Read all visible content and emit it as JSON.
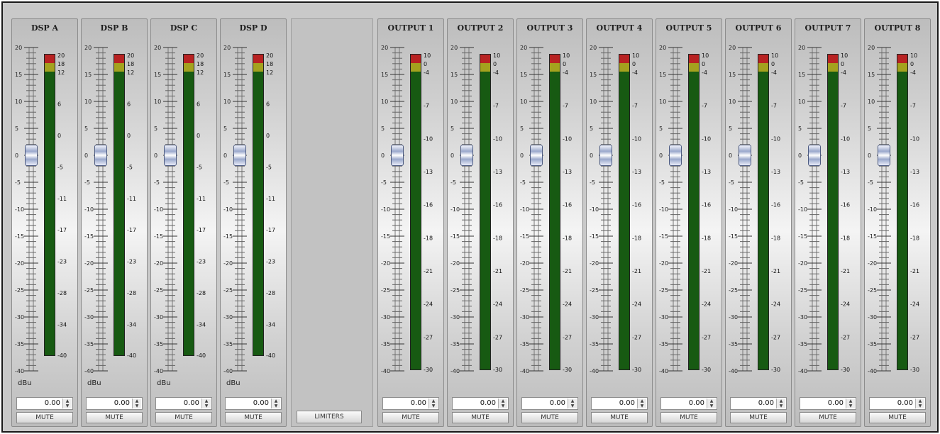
{
  "channels": [
    {
      "name": "DSP A",
      "kind": "dsp"
    },
    {
      "name": "DSP B",
      "kind": "dsp"
    },
    {
      "name": "DSP C",
      "kind": "dsp"
    },
    {
      "name": "DSP D",
      "kind": "dsp"
    },
    {
      "name": "OUTPUT 1",
      "kind": "output"
    },
    {
      "name": "OUTPUT 2",
      "kind": "output"
    },
    {
      "name": "OUTPUT 3",
      "kind": "output"
    },
    {
      "name": "OUTPUT 4",
      "kind": "output"
    },
    {
      "name": "OUTPUT 5",
      "kind": "output"
    },
    {
      "name": "OUTPUT 6",
      "kind": "output"
    },
    {
      "name": "OUTPUT 7",
      "kind": "output"
    },
    {
      "name": "OUTPUT 8",
      "kind": "output"
    }
  ],
  "fader": {
    "scale_labels": [
      "20",
      "15",
      "10",
      "5",
      "0",
      "-5",
      "-10",
      "-15",
      "-20",
      "-25",
      "-30",
      "-35",
      "-40"
    ],
    "scale_max": 20,
    "scale_min": -40,
    "position_db": 0
  },
  "meter": {
    "dsp_labels": [
      "20",
      "18",
      "12",
      "6",
      "0",
      "-5",
      "-11",
      "-17",
      "-23",
      "-28",
      "-34",
      "-40"
    ],
    "output_labels": [
      "10",
      "0",
      "-4",
      "-7",
      "-10",
      "-13",
      "-16",
      "-18",
      "-21",
      "-24",
      "-27",
      "-30"
    ],
    "colors": {
      "red": "#b82222",
      "yellow": "#a4a21e",
      "green": "#175a12"
    }
  },
  "unit_label": "dBu",
  "gain_value": "0.00",
  "mute_label": "MUTE",
  "limiters_label": "LIMITERS",
  "spin_up_glyph": "▲",
  "spin_down_glyph": "▼"
}
